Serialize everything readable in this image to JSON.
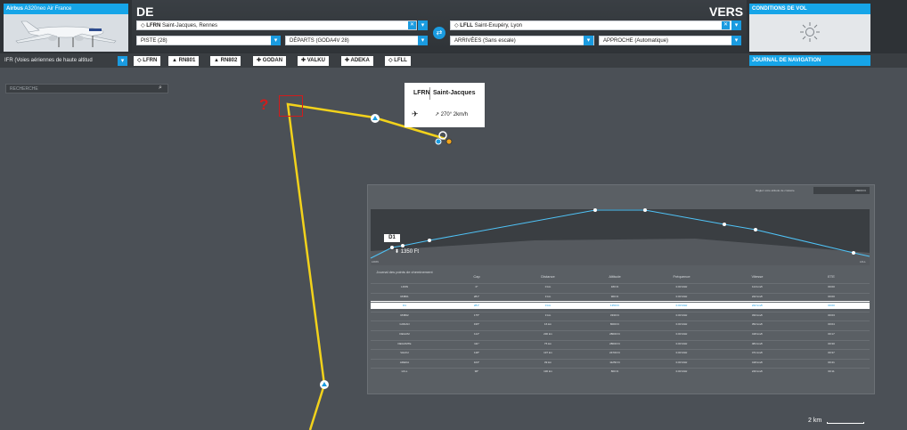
{
  "aircraft": {
    "brand": "Airbus",
    "model": "A320neo Air France"
  },
  "header": {
    "from_label": "DE",
    "to_label": "VERS",
    "departure": {
      "airport": "LFRN",
      "name": "Saint-Jacques, Rennes"
    },
    "arrival": {
      "airport": "LFLL",
      "name": "Saint-Exupéry, Lyon"
    },
    "runway": "PISTE (28)",
    "departures": "DÉPARTS (GODA4V 28)",
    "arrivals": "ARRIVÉES (Sans escale)",
    "approach": "APPROCHE (Automatique)"
  },
  "weather": {
    "title": "CONDITIONS DE VOL",
    "icon": "sun-icon"
  },
  "route": {
    "mode": "IFR (Voies aériennes de haute altitud",
    "waypoints": [
      {
        "id": "LFRN",
        "glyph": "◇"
      },
      {
        "id": "RN801",
        "glyph": "▲"
      },
      {
        "id": "RN802",
        "glyph": "▲"
      },
      {
        "id": "GODAN",
        "glyph": "✚"
      },
      {
        "id": "VALKU",
        "glyph": "✚"
      },
      {
        "id": "ADEKA",
        "glyph": "✚"
      },
      {
        "id": "LFLL",
        "glyph": "◇"
      }
    ],
    "nav_log": "JOURNAL DE NAVIGATION"
  },
  "search": {
    "placeholder": "RECHERCHE"
  },
  "popup": {
    "id": "LFRN",
    "name": "Saint-Jacques",
    "wind": "270° 2km/h"
  },
  "annotations": {
    "qmark": "?"
  },
  "profile": {
    "header_label": "Réglez votre altitude de croisière",
    "cruise_value": "28000 Ft",
    "d1_label": "D1",
    "altitude_label": "1350 Ft",
    "axis_left": "LFRN",
    "axis_right": "LFLL"
  },
  "table": {
    "headers": [
      "Journal des points de cheminement",
      "Cap",
      "Distance",
      "Altitude",
      "Fréquence",
      "Vitesse",
      "ETE"
    ],
    "rows": [
      [
        "LFRN",
        "0°",
        "0 km",
        "180 Ft",
        "0.00 MHz",
        "114 km/h",
        "00:00"
      ],
      [
        "RN801",
        "281°",
        "3 km",
        "960 Ft",
        "0.00 MHz",
        "222 km/h",
        "00:00"
      ],
      [
        "D1",
        "281°",
        "0 km",
        "1350 Ft",
        "0.00 MHz",
        "222 km/h",
        "00:00"
      ],
      [
        "RN802",
        "175°",
        "3 km",
        "3330 Ft",
        "0.00 MHz",
        "333 km/h",
        "00:03"
      ],
      [
        "GODAN",
        "195°",
        "16 km",
        "8000 Ft",
        "0.00 MHz",
        "352 km/h",
        "00:04"
      ],
      [
        "DEGUM",
        "114°",
        "230 km",
        "28000 Ft",
        "0.00 MHz",
        "418 km/h",
        "00:17"
      ],
      [
        "DEGUMTE",
        "111°",
        "75 km",
        "28000 Ft",
        "0.00 MHz",
        "484 km/h",
        "00:30"
      ],
      [
        "VALKU",
        "118°",
        "137 km",
        "24700 Ft",
        "0.00 MHz",
        "471 km/h",
        "00:37"
      ],
      [
        "ADEKA",
        "103°",
        "39 km",
        "11250 Ft",
        "0.00 MHz",
        "418 km/h",
        "00:41"
      ],
      [
        "LFLL",
        "96°",
        "130 km",
        "800 Ft",
        "0.00 MHz",
        "240 km/h",
        "00:11"
      ]
    ]
  },
  "map": {
    "scale": "2 km"
  },
  "colors": {
    "accent": "#16a5e8",
    "route": "#f2d21b",
    "profile_line": "#4fc3f7",
    "annotation": "#d11c1c"
  }
}
